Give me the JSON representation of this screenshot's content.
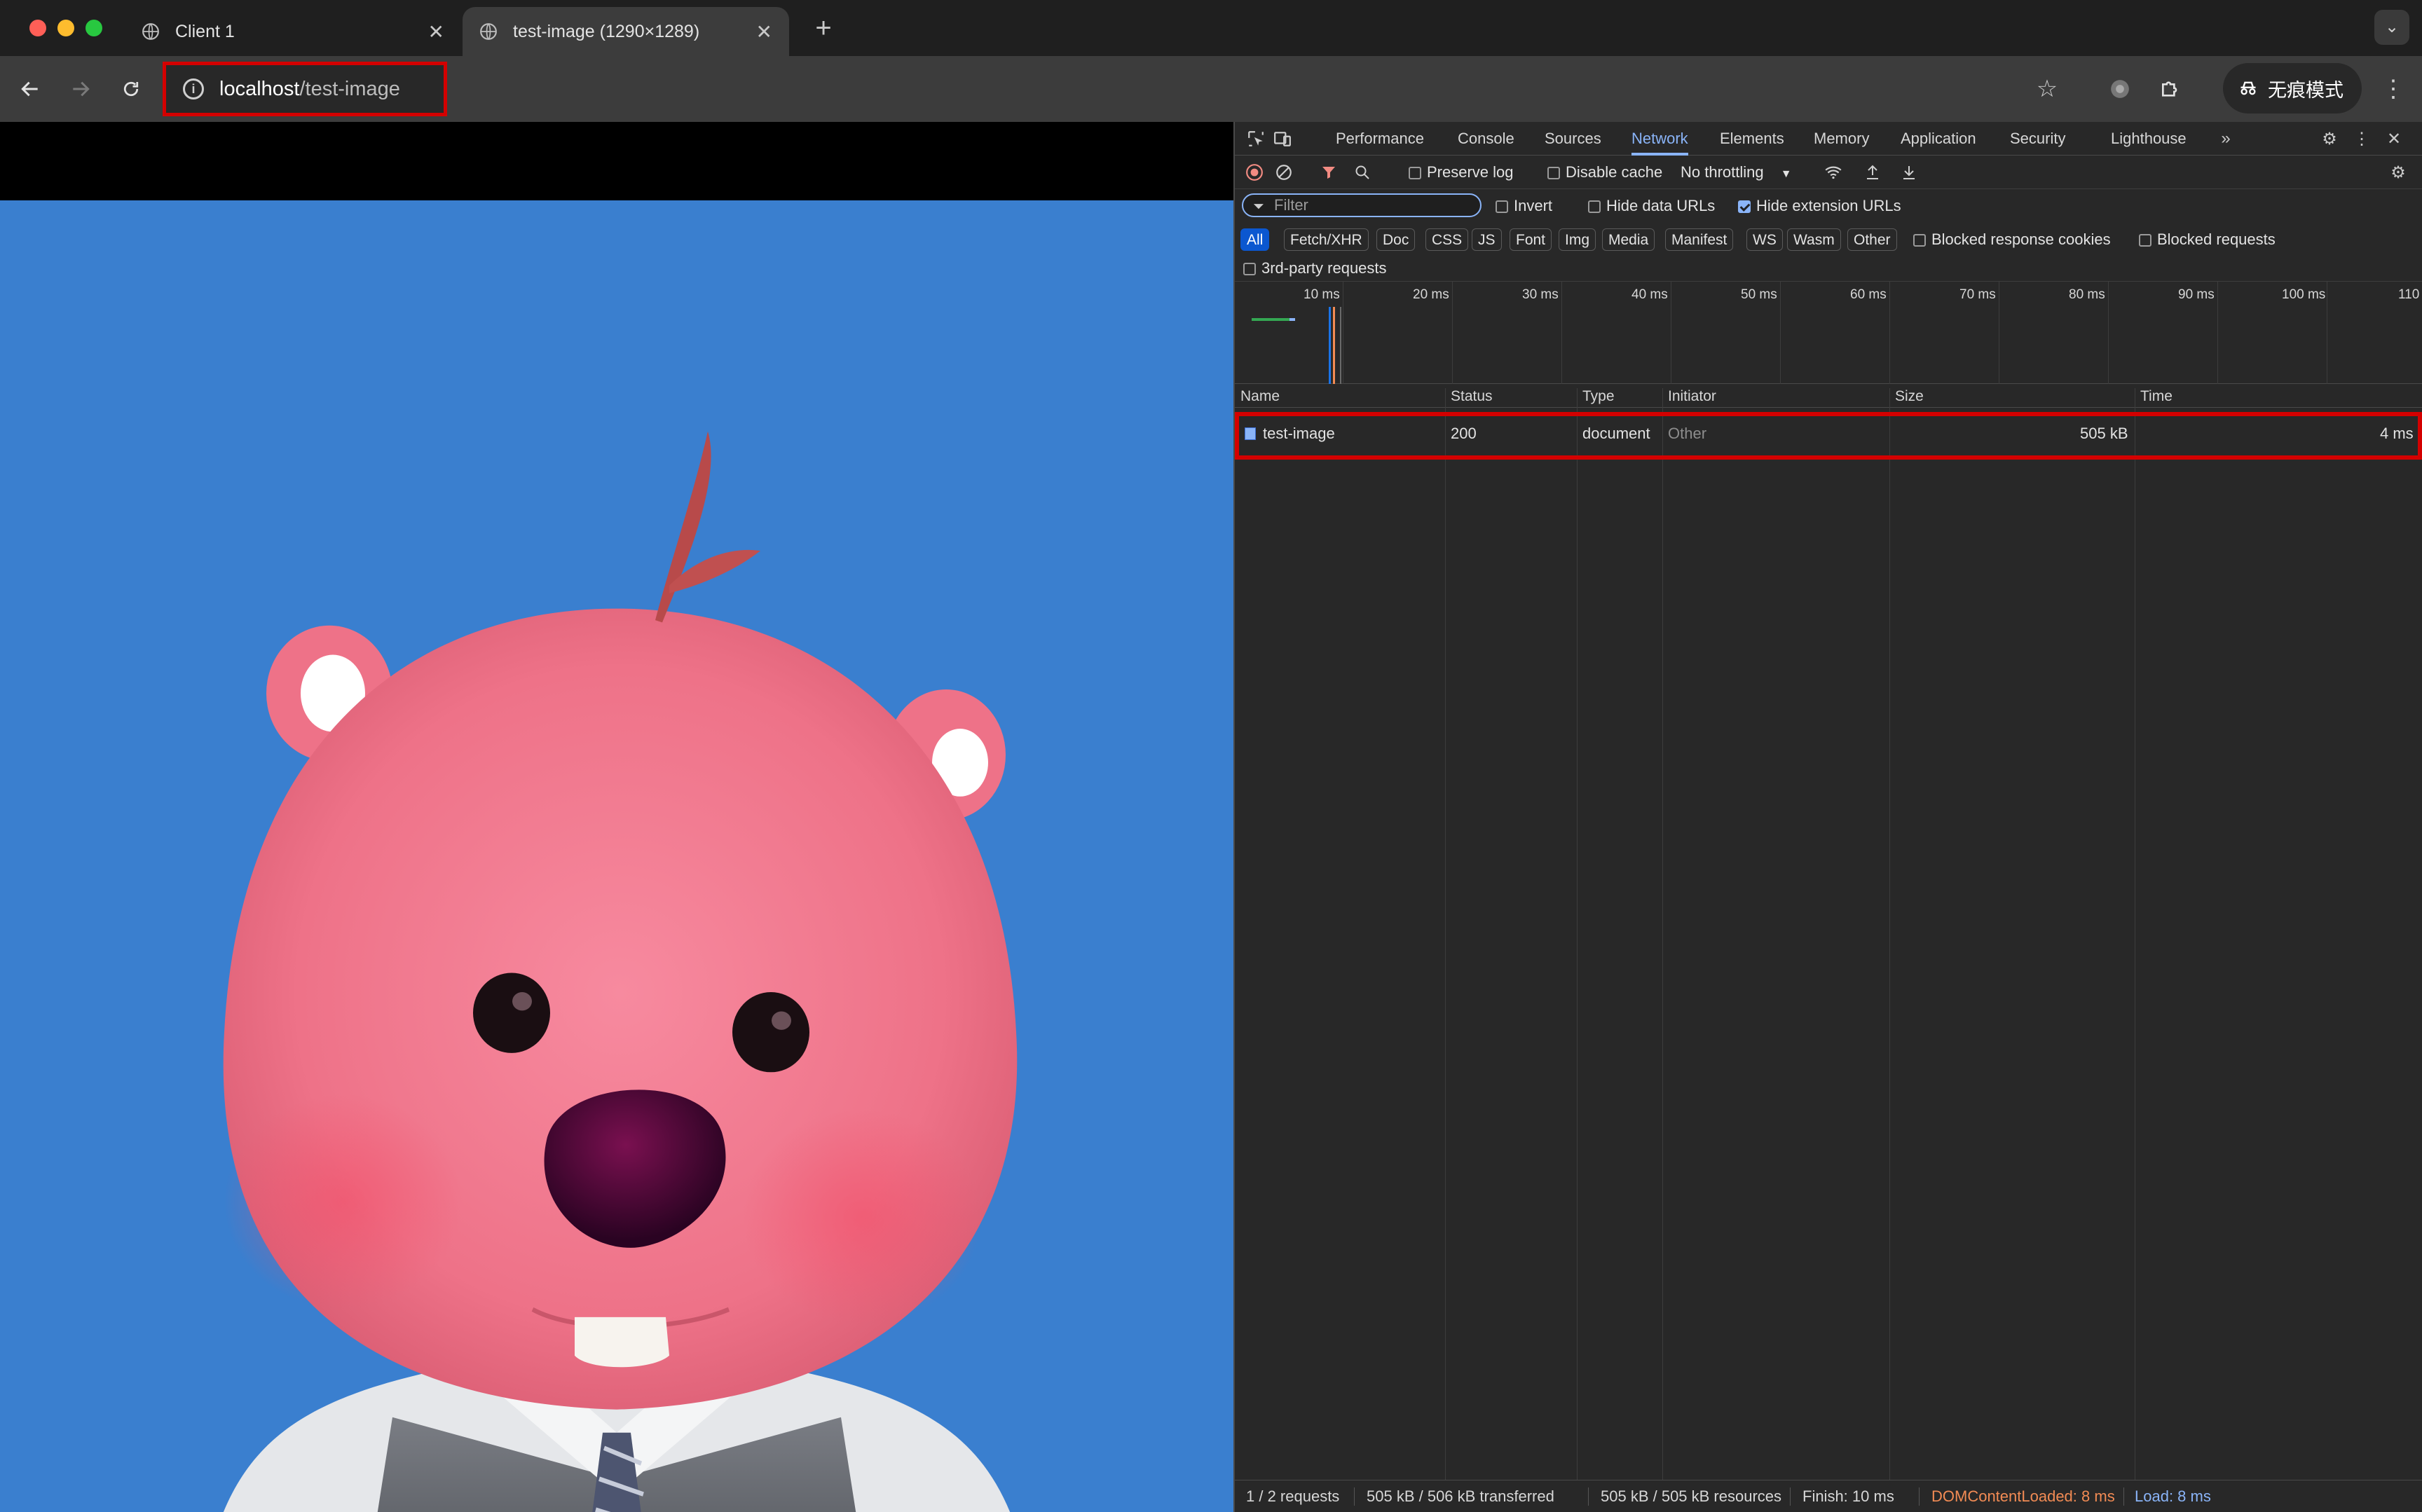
{
  "browser": {
    "tabs": [
      {
        "title": "Client 1",
        "active": false
      },
      {
        "title": "test-image (1290×1289)",
        "active": true
      }
    ],
    "new_tab_label": "+",
    "address": {
      "host": "localhost",
      "path": "/test-image"
    },
    "incognito_label": "无痕模式"
  },
  "page": {
    "image_description_icon": "pink-beaver-character-image"
  },
  "devtools": {
    "tabs": [
      "Performance",
      "Console",
      "Sources",
      "Network",
      "Elements",
      "Memory",
      "Application",
      "Security",
      "Lighthouse"
    ],
    "active_tab": "Network",
    "toolbar": {
      "preserve_log": "Preserve log",
      "disable_cache": "Disable cache",
      "throttling": "No throttling"
    },
    "filter": {
      "placeholder": "Filter",
      "invert": "Invert",
      "hide_data_urls": "Hide data URLs",
      "hide_extension_urls": "Hide extension URLs"
    },
    "type_chips": [
      "All",
      "Fetch/XHR",
      "Doc",
      "CSS",
      "JS",
      "Font",
      "Img",
      "Media",
      "Manifest",
      "WS",
      "Wasm",
      "Other"
    ],
    "blocked_response_cookies": "Blocked response cookies",
    "blocked_requests": "Blocked requests",
    "third_party": "3rd-party requests",
    "overview_ticks": [
      "10 ms",
      "20 ms",
      "30 ms",
      "40 ms",
      "50 ms",
      "60 ms",
      "70 ms",
      "80 ms",
      "90 ms",
      "100 ms",
      "110"
    ],
    "columns": [
      "Name",
      "Status",
      "Type",
      "Initiator",
      "Size",
      "Time"
    ],
    "requests": [
      {
        "name": "test-image",
        "status": "200",
        "type": "document",
        "initiator": "Other",
        "size": "505 kB",
        "time": "4 ms"
      }
    ],
    "summary": {
      "requests": "1 / 2 requests",
      "transferred": "505 kB / 506 kB transferred",
      "resources": "505 kB / 505 kB resources",
      "finish": "Finish: 10 ms",
      "dom_content_loaded": "DOMContentLoaded: 8 ms",
      "load": "Load: 8 ms"
    }
  }
}
